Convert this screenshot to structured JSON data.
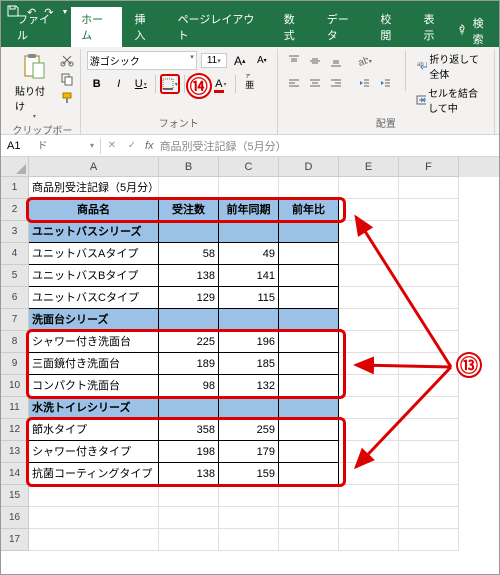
{
  "titlebar": {
    "save_icon": "save",
    "undo_icon": "undo",
    "redo_icon": "redo"
  },
  "tabs": {
    "file": "ファイル",
    "home": "ホーム",
    "insert": "挿入",
    "layout": "ページレイアウト",
    "formula": "数式",
    "data": "データ",
    "review": "校閲",
    "view": "表示",
    "search": "検索"
  },
  "ribbon": {
    "paste": "貼り付け",
    "clipboard_label": "クリップボード",
    "font_name": "游ゴシック",
    "font_size": "11",
    "font_label": "フォント",
    "align_label": "配置",
    "wrap": "折り返して全体",
    "merge": "セルを結合して中",
    "bold": "B",
    "italic": "I",
    "underline": "U"
  },
  "namebox": "A1",
  "formula_bar": "商品別受注記録（5月分）",
  "columns": [
    "A",
    "B",
    "C",
    "D",
    "E",
    "F"
  ],
  "sheet": {
    "title": "商品別受注記録（5月分）",
    "headers": [
      "商品名",
      "受注数",
      "前年同期",
      "前年比"
    ],
    "cat1": "ユニットバスシリーズ",
    "r4": [
      "ユニットバスAタイプ",
      "58",
      "49"
    ],
    "r5": [
      "ユニットバスBタイプ",
      "138",
      "141"
    ],
    "r6": [
      "ユニットバスCタイプ",
      "129",
      "115"
    ],
    "cat2": "洗面台シリーズ",
    "r8": [
      "シャワー付き洗面台",
      "225",
      "196"
    ],
    "r9": [
      "三面鏡付き洗面台",
      "189",
      "185"
    ],
    "r10": [
      "コンパクト洗面台",
      "98",
      "132"
    ],
    "cat3": "水洗トイレシリーズ",
    "r12": [
      "節水タイプ",
      "358",
      "259"
    ],
    "r13": [
      "シャワー付きタイプ",
      "198",
      "179"
    ],
    "r14": [
      "抗菌コーティングタイプ",
      "138",
      "159"
    ]
  },
  "callouts": {
    "c13": "⑬",
    "c14": "⑭"
  }
}
